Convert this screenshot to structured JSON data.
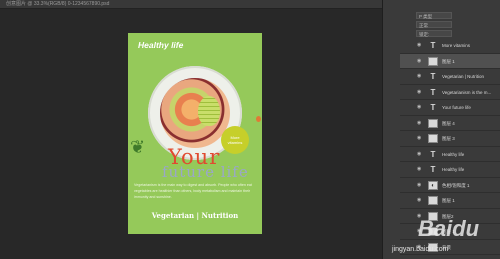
{
  "titlebar": {
    "text": "创意图片 @ 33.3%(RGB/8) 0-1234567890.psd"
  },
  "document": {
    "title": "Healthy life",
    "badge_line1": "More",
    "badge_line2": "vitamins",
    "headline1": "Your",
    "headline2": "future life",
    "paragraph": "Vegetarianism is the main way to digest and absorb. People who often eat vegetables are healthier than others, body metabolism and maintain their immunity and sunshine.",
    "footer": "Vegetarian | Nutrition"
  },
  "panel": {
    "tools": [
      "A",
      "¶",
      "◧",
      "⊞",
      "✎",
      "⌂",
      "◐",
      "✦",
      "▤",
      "◫",
      "▣",
      "⇄"
    ],
    "mode": "正常",
    "lock": "锁定:",
    "search": "P 类型"
  },
  "layers": [
    {
      "type": "text",
      "name": "More vitamins",
      "selected": false
    },
    {
      "type": "image",
      "name": "图层 1",
      "selected": true
    },
    {
      "type": "text",
      "name": "Vegetarian | Nutrition",
      "selected": false
    },
    {
      "type": "text",
      "name": "Vegetarianism is the m...",
      "selected": false
    },
    {
      "type": "text",
      "name": "Your future life",
      "selected": false
    },
    {
      "type": "image",
      "name": "图层 4",
      "selected": false
    },
    {
      "type": "image",
      "name": "图层 3",
      "selected": false
    },
    {
      "type": "text",
      "name": "Healthy life",
      "selected": false
    },
    {
      "type": "text",
      "name": "Healthy life",
      "selected": false
    },
    {
      "type": "image",
      "name": "色相/饱和度 1",
      "selected": false
    },
    {
      "type": "image",
      "name": "图层 1",
      "selected": false
    },
    {
      "type": "image",
      "name": "图层2",
      "selected": false
    },
    {
      "type": "image",
      "name": "图层 1",
      "selected": false
    },
    {
      "type": "image",
      "name": "背景",
      "selected": false
    }
  ],
  "watermark": {
    "logo": "Baidu",
    "url": "jingyan.baidu.com"
  }
}
